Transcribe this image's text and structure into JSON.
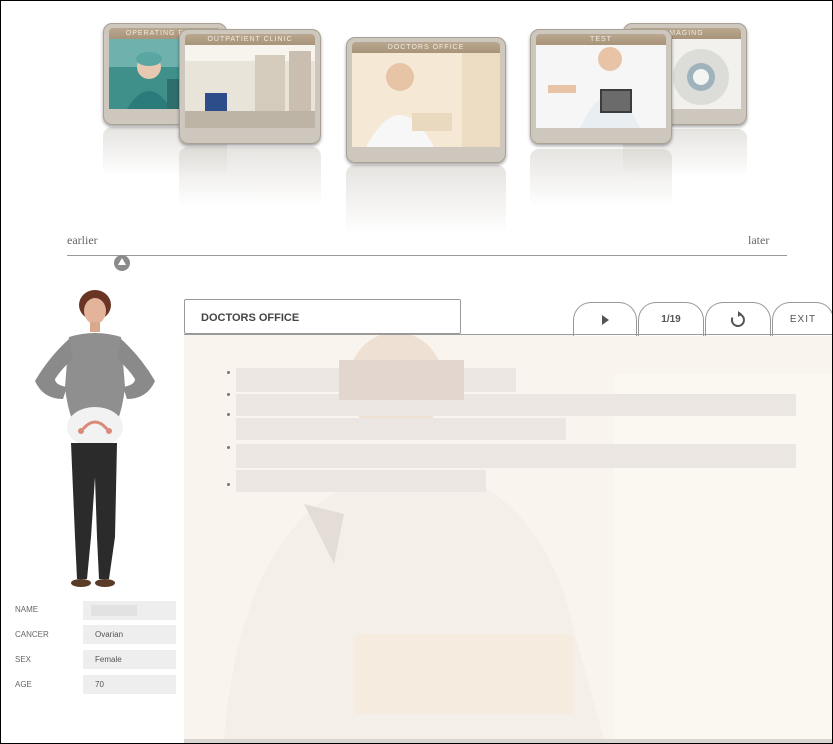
{
  "carousel": {
    "cards": [
      {
        "label": "OPERATING ROOM"
      },
      {
        "label": "OUTPATIENT CLINIC"
      },
      {
        "label": "DOCTORS OFFICE"
      },
      {
        "label": "TEST"
      },
      {
        "label": "IMAGING"
      }
    ]
  },
  "timeline": {
    "earlier_label": "earlier",
    "later_label": "later"
  },
  "patient": {
    "fields": [
      {
        "label": "NAME",
        "value": ""
      },
      {
        "label": "CANCER",
        "value": "Ovarian"
      },
      {
        "label": "SEX",
        "value": "Female"
      },
      {
        "label": "AGE",
        "value": "70"
      }
    ]
  },
  "content": {
    "title": "DOCTORS OFFICE",
    "page_indicator": "1/19",
    "exit_label": "EXIT",
    "play_icon": "play-icon",
    "replay_icon": "replay-icon"
  }
}
